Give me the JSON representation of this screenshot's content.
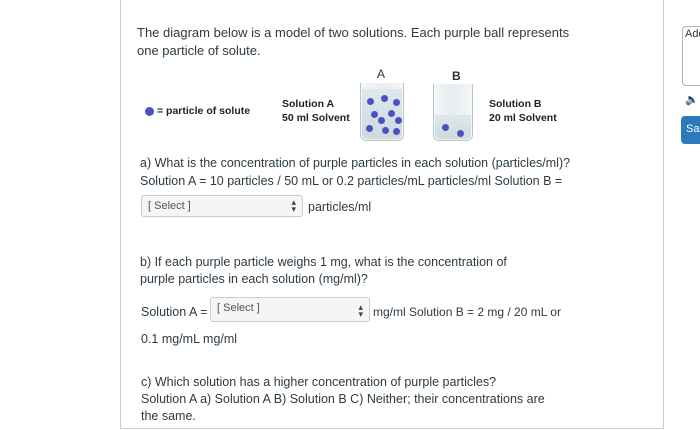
{
  "intro": "The diagram below is a model of two solutions. Each purple ball represents one particle of solute.",
  "diagram": {
    "legend": "= particle of solute",
    "beaker_a_letter": "A",
    "beaker_b_letter": "B",
    "solution_a_title": "Solution A",
    "solution_a_volume": "50 ml Solvent",
    "solution_b_title": "Solution B",
    "solution_b_volume": "20 ml Solvent",
    "particle_color": "#4a52c2"
  },
  "question_a": {
    "prompt": "a) What is the concentration of purple particles in each solution (particles/ml)?",
    "line2": "Solution A = 10 particles / 50 mL or 0.2 particles/mL particles/ml Solution B =",
    "select_value": "[ Select ]",
    "unit": "particles/ml"
  },
  "question_b": {
    "prompt": "b) If each purple particle weighs 1 mg, what is the concentration of purple particles in each solution (mg/ml)?",
    "label_a": "Solution A =",
    "select_value": "[ Select ]",
    "after_select": "mg/ml Solution B = 2 mg / 20 mL or",
    "line3": "0.1 mg/mL mg/ml"
  },
  "question_c": {
    "prompt": "c) Which solution has a higher concentration of purple particles?",
    "options": "Solution A a) Solution A B) Solution B C) Neither; their concentrations are the same."
  },
  "sidebar": {
    "add_label": "Add",
    "speaker_icon": "speaker-icon",
    "save_label": "Sa"
  }
}
